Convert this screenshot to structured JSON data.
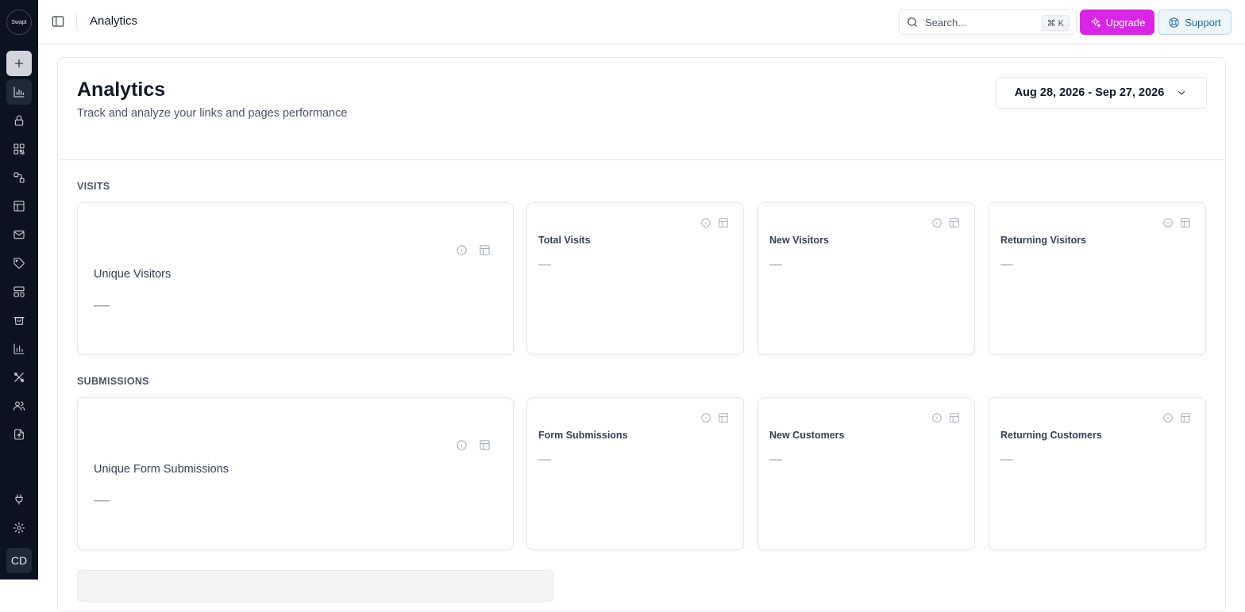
{
  "sidebar": {
    "logo_text": "Swapt",
    "avatar_initials": "CD",
    "items": [
      {
        "name": "add-icon"
      },
      {
        "name": "analytics-icon"
      },
      {
        "name": "lock-icon"
      },
      {
        "name": "qr-code-icon"
      },
      {
        "name": "workflow-icon"
      },
      {
        "name": "layout-icon"
      },
      {
        "name": "mail-icon"
      },
      {
        "name": "tag-icon"
      },
      {
        "name": "grid-icon"
      },
      {
        "name": "shopping-bag-icon"
      },
      {
        "name": "chart-icon"
      },
      {
        "name": "tools-icon"
      },
      {
        "name": "users-icon"
      },
      {
        "name": "file-upload-icon"
      },
      {
        "name": "plug-icon"
      },
      {
        "name": "gear-icon"
      }
    ]
  },
  "topbar": {
    "title": "Analytics",
    "search_placeholder": "Search...",
    "search_shortcut": "⌘ K",
    "upgrade_label": "Upgrade",
    "support_label": "Support"
  },
  "header": {
    "title": "Analytics",
    "subtitle": "Track and analyze your links and pages performance",
    "date_range": "Aug 28, 2026 - Sep 27, 2026"
  },
  "sections": {
    "visits": {
      "label": "VISITS",
      "big_card": {
        "label": "Unique Visitors",
        "value": "—"
      },
      "cards": [
        {
          "label": "Total Visits",
          "value": "—"
        },
        {
          "label": "New Visitors",
          "value": "—"
        },
        {
          "label": "Returning Visitors",
          "value": "—"
        }
      ]
    },
    "submissions": {
      "label": "SUBMISSIONS",
      "big_card": {
        "label": "Unique Form Submissions",
        "value": "—"
      },
      "cards": [
        {
          "label": "Form Submissions",
          "value": "—"
        },
        {
          "label": "New Customers",
          "value": "—"
        },
        {
          "label": "Returning Customers",
          "value": "—"
        }
      ]
    }
  },
  "colors": {
    "sidebar_bg": "#0b1220",
    "upgrade_bg": "#d926e6",
    "support_fg": "#1d6a9c"
  }
}
